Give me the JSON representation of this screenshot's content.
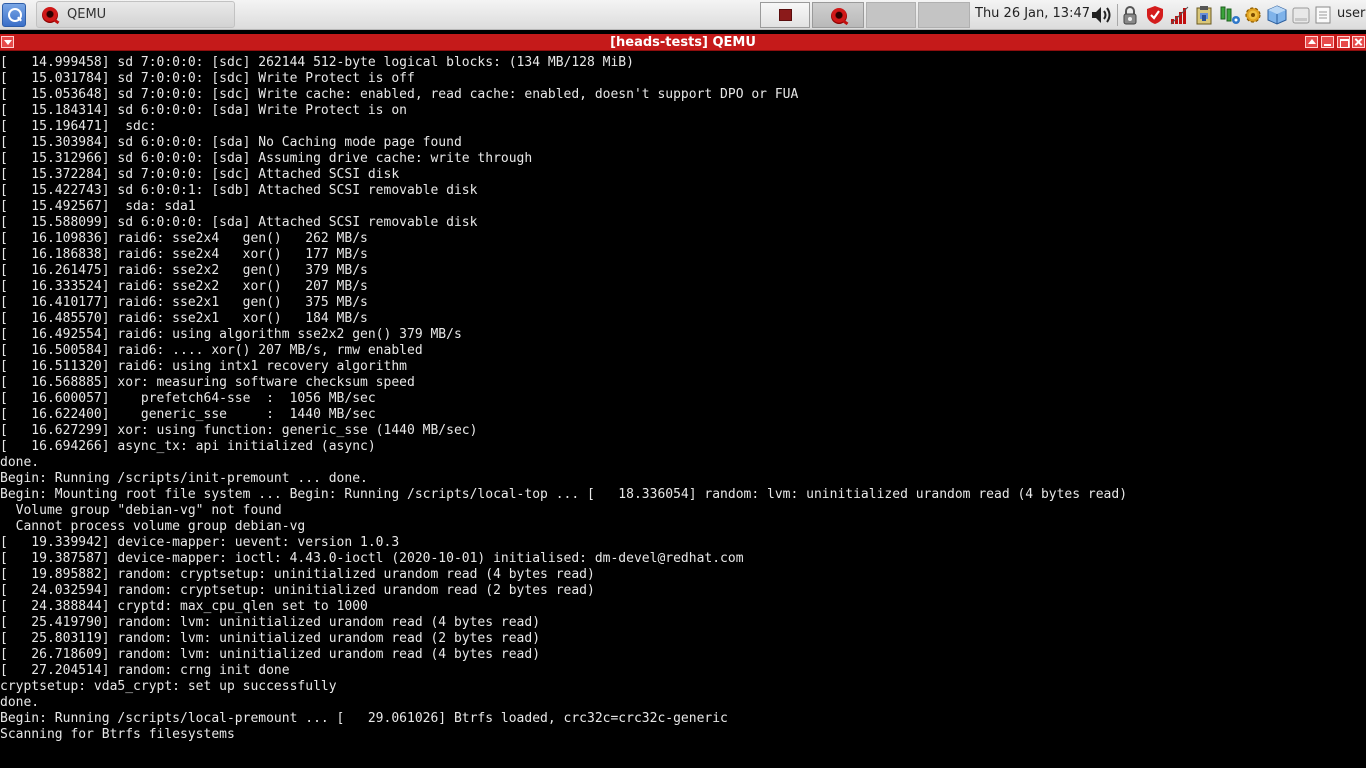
{
  "taskbar": {
    "task_label": "QEMU",
    "clock": "Thu 26 Jan, 13:47",
    "user": "user",
    "icons": [
      "menu-icon",
      "qemu-icon",
      "volume-icon",
      "lock-icon",
      "shield-icon",
      "signal-icon",
      "clipboard-icon",
      "network-icon",
      "gear-icon",
      "cube-icon",
      "drive-icon",
      "notes-icon"
    ]
  },
  "window": {
    "title": "[heads-tests] QEMU"
  },
  "colors": {
    "titlebar": "#c51a1a",
    "console_bg": "#000000",
    "console_fg": "#e8e8e8"
  },
  "console": {
    "lines": [
      "[   14.999458] sd 7:0:0:0: [sdc] 262144 512-byte logical blocks: (134 MB/128 MiB)",
      "[   15.031784] sd 7:0:0:0: [sdc] Write Protect is off",
      "[   15.053648] sd 7:0:0:0: [sdc] Write cache: enabled, read cache: enabled, doesn't support DPO or FUA",
      "[   15.184314] sd 6:0:0:0: [sda] Write Protect is on",
      "[   15.196471]  sdc:",
      "[   15.303984] sd 6:0:0:0: [sda] No Caching mode page found",
      "[   15.312966] sd 6:0:0:0: [sda] Assuming drive cache: write through",
      "[   15.372284] sd 7:0:0:0: [sdc] Attached SCSI disk",
      "[   15.422743] sd 6:0:0:1: [sdb] Attached SCSI removable disk",
      "[   15.492567]  sda: sda1",
      "[   15.588099] sd 6:0:0:0: [sda] Attached SCSI removable disk",
      "[   16.109836] raid6: sse2x4   gen()   262 MB/s",
      "[   16.186838] raid6: sse2x4   xor()   177 MB/s",
      "[   16.261475] raid6: sse2x2   gen()   379 MB/s",
      "[   16.333524] raid6: sse2x2   xor()   207 MB/s",
      "[   16.410177] raid6: sse2x1   gen()   375 MB/s",
      "[   16.485570] raid6: sse2x1   xor()   184 MB/s",
      "[   16.492554] raid6: using algorithm sse2x2 gen() 379 MB/s",
      "[   16.500584] raid6: .... xor() 207 MB/s, rmw enabled",
      "[   16.511320] raid6: using intx1 recovery algorithm",
      "[   16.568885] xor: measuring software checksum speed",
      "[   16.600057]    prefetch64-sse  :  1056 MB/sec",
      "[   16.622400]    generic_sse     :  1440 MB/sec",
      "[   16.627299] xor: using function: generic_sse (1440 MB/sec)",
      "[   16.694266] async_tx: api initialized (async)",
      "done.",
      "Begin: Running /scripts/init-premount ... done.",
      "Begin: Mounting root file system ... Begin: Running /scripts/local-top ... [   18.336054] random: lvm: uninitialized urandom read (4 bytes read)",
      "  Volume group \"debian-vg\" not found",
      "  Cannot process volume group debian-vg",
      "[   19.339942] device-mapper: uevent: version 1.0.3",
      "[   19.387587] device-mapper: ioctl: 4.43.0-ioctl (2020-10-01) initialised: dm-devel@redhat.com",
      "[   19.895882] random: cryptsetup: uninitialized urandom read (4 bytes read)",
      "[   24.032594] random: cryptsetup: uninitialized urandom read (2 bytes read)",
      "[   24.388844] cryptd: max_cpu_qlen set to 1000",
      "[   25.419790] random: lvm: uninitialized urandom read (4 bytes read)",
      "[   25.803119] random: lvm: uninitialized urandom read (2 bytes read)",
      "[   26.718609] random: lvm: uninitialized urandom read (4 bytes read)",
      "[   27.204514] random: crng init done",
      "cryptsetup: vda5_crypt: set up successfully",
      "done.",
      "Begin: Running /scripts/local-premount ... [   29.061026] Btrfs loaded, crc32c=crc32c-generic",
      "Scanning for Btrfs filesystems"
    ]
  }
}
